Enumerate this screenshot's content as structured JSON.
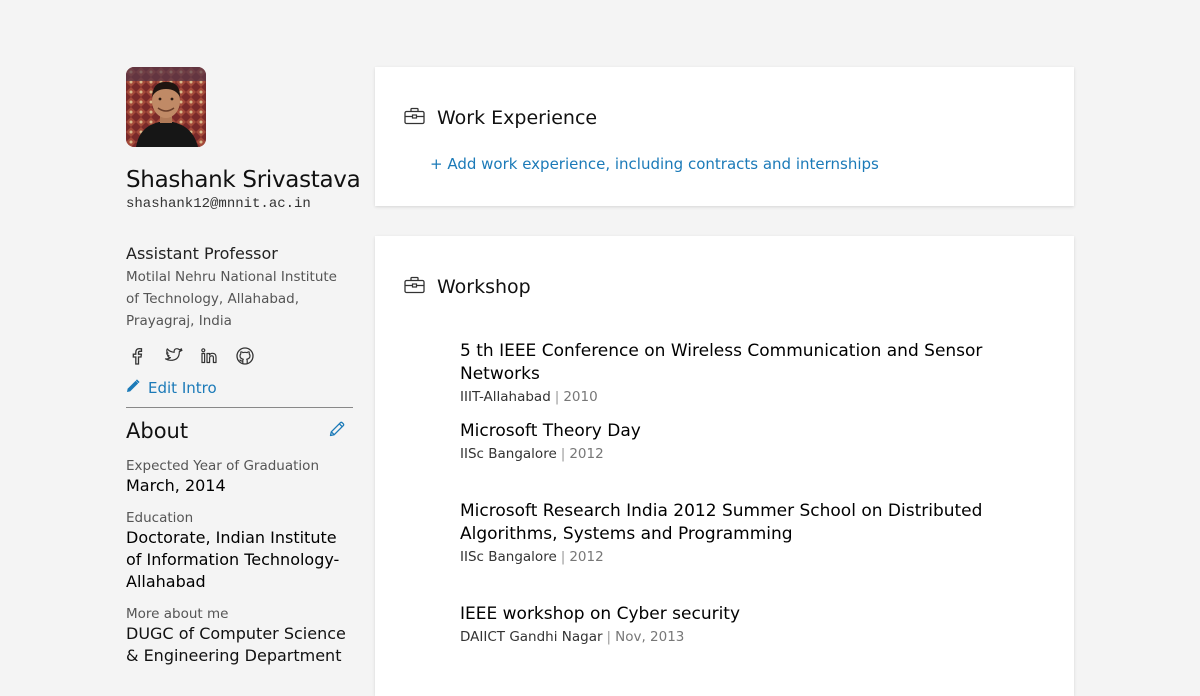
{
  "profile": {
    "name": "Shashank Srivastava",
    "email": "shashank12@mnnit.ac.in",
    "title": "Assistant Professor",
    "organization": "Motilal Nehru National Institute of Technology, Allahabad, Prayagraj, India",
    "edit_intro_label": "Edit Intro",
    "social": [
      "facebook-icon",
      "twitter-icon",
      "linkedin-icon",
      "github-icon"
    ]
  },
  "about": {
    "heading": "About",
    "graduation_label": "Expected Year of Graduation",
    "graduation_value": "March, 2014",
    "education_label": "Education",
    "education_value": "Doctorate, Indian Institute of Information Technology-Allahabad",
    "more_label": "More about me",
    "more_value": "DUGC of Computer Science & Engineering Department"
  },
  "work_experience": {
    "heading": "Work Experience",
    "add_link": "+ Add work experience, including contracts and internships"
  },
  "workshop": {
    "heading": "Workshop",
    "items": [
      {
        "title": "5 th IEEE Conference on Wireless Communication and Sensor Networks",
        "place": "IIIT-Allahabad",
        "sep": "|",
        "year": "2010"
      },
      {
        "title": "Microsoft Theory Day",
        "place": "IISc Bangalore",
        "sep": "|",
        "year": "2012"
      },
      {
        "title": "Microsoft Research India 2012 Summer School on Distributed Algorithms, Systems and Programming",
        "place": "IISc Bangalore",
        "sep": "|",
        "year": "2012"
      },
      {
        "title": "IEEE workshop on Cyber security",
        "place": "DAIICT Gandhi Nagar",
        "sep": "|",
        "year": "Nov, 2013"
      }
    ]
  },
  "colors": {
    "link": "#1b7ab8",
    "background": "#f4f4f4",
    "card": "#ffffff"
  }
}
